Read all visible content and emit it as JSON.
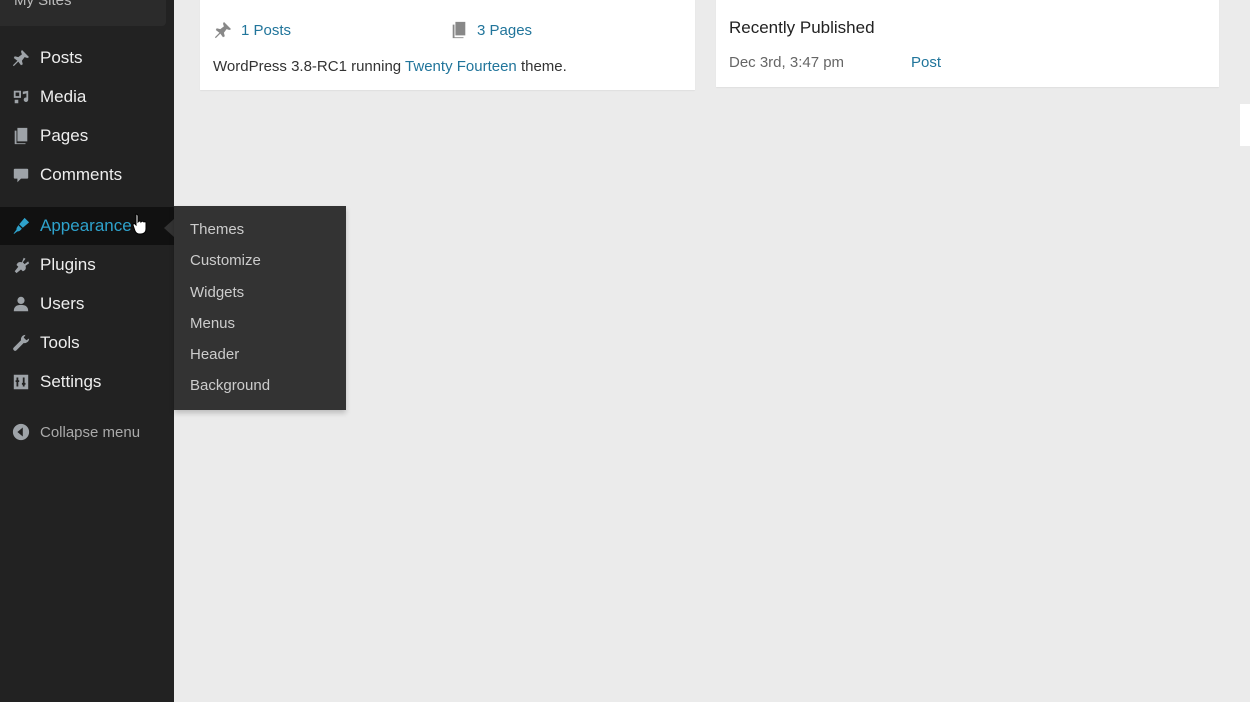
{
  "sidebar": {
    "my_sites": "My Sites",
    "items": [
      {
        "label": "Posts",
        "icon": "pin-icon"
      },
      {
        "label": "Media",
        "icon": "media-icon"
      },
      {
        "label": "Pages",
        "icon": "pages-icon"
      },
      {
        "label": "Comments",
        "icon": "comment-icon"
      },
      {
        "label": "Appearance",
        "icon": "brush-icon",
        "active": true
      },
      {
        "label": "Plugins",
        "icon": "plugin-icon"
      },
      {
        "label": "Users",
        "icon": "user-icon"
      },
      {
        "label": "Tools",
        "icon": "wrench-icon"
      },
      {
        "label": "Settings",
        "icon": "settings-icon"
      }
    ],
    "collapse": "Collapse menu"
  },
  "appearance_submenu": {
    "items": [
      "Themes",
      "Customize",
      "Widgets",
      "Menus",
      "Header",
      "Background"
    ]
  },
  "at_a_glance": {
    "posts": "1 Posts",
    "pages": "3 Pages",
    "version_prefix": "WordPress 3.8-RC1 running ",
    "theme_link": "Twenty Fourteen",
    "version_suffix": " theme."
  },
  "activity": {
    "title": "Recently Published",
    "date": "Dec 3rd, 3:47 pm",
    "post_link": "Post"
  },
  "colors": {
    "sidebar_bg": "#222222",
    "accent": "#2ea2cc",
    "link": "#21759b",
    "content_bg": "#ebebeb"
  }
}
